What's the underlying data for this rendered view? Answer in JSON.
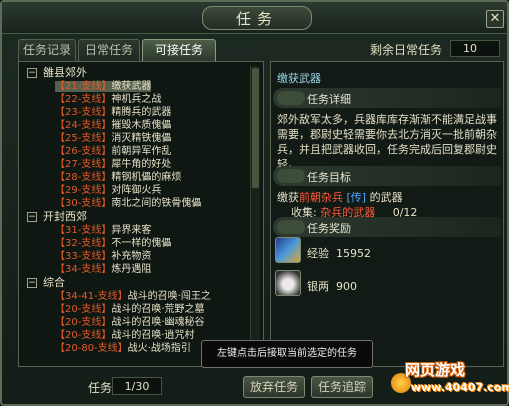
{
  "window": {
    "title": "任务",
    "close_label": "✕"
  },
  "tabs": [
    {
      "label": "任务记录"
    },
    {
      "label": "日常任务"
    },
    {
      "label": "可接任务"
    }
  ],
  "remaining": {
    "label": "剩余日常任务",
    "value": "10"
  },
  "tree": {
    "groups": [
      {
        "name": "雒县郊外",
        "toggle": "−",
        "tasks": [
          {
            "prefix": "【21-支线】",
            "text": "缴获武器",
            "selected": true
          },
          {
            "prefix": "【22-支线】",
            "text": "神机兵之战"
          },
          {
            "prefix": "【23-支线】",
            "text": "精腾兵的武器"
          },
          {
            "prefix": "【24-支线】",
            "text": "摧毁木质傀儡"
          },
          {
            "prefix": "【25-支线】",
            "text": "消灭精铁傀儡"
          },
          {
            "prefix": "【26-支线】",
            "text": "前朝异军作乱"
          },
          {
            "prefix": "【27-支线】",
            "text": "犀牛角的好处"
          },
          {
            "prefix": "【28-支线】",
            "text": "精钢机儡的麻烦"
          },
          {
            "prefix": "【29-支线】",
            "text": "对阵御火兵"
          },
          {
            "prefix": "【30-支线】",
            "text": "南北之间的铁骨傀儡"
          }
        ]
      },
      {
        "name": "开封西郊",
        "toggle": "−",
        "tasks": [
          {
            "prefix": "【31-支线】",
            "text": "异界来客"
          },
          {
            "prefix": "【32-支线】",
            "text": "不一样的傀儡"
          },
          {
            "prefix": "【33-支线】",
            "text": "补充物资"
          },
          {
            "prefix": "【34-支线】",
            "text": "炼丹遇阻"
          }
        ]
      },
      {
        "name": "综合",
        "toggle": "−",
        "tasks": [
          {
            "prefix": "【34-41-支线】",
            "text": "战斗的召唤·闯王之"
          },
          {
            "prefix": "【20-支线】",
            "text": "战斗的召唤·荒野之墓"
          },
          {
            "prefix": "【20-支线】",
            "text": "战斗的召唤·幽魂秘谷"
          },
          {
            "prefix": "【20-支线】",
            "text": "战斗的召唤·逍咒村"
          },
          {
            "prefix": "【20-80-支线】",
            "text": "战火·战场指引"
          }
        ]
      }
    ]
  },
  "detail": {
    "title": "缴获武器",
    "section_detail": "任务详细",
    "description": "郊外敌军太多，兵器库库存渐渐不能满足战事需要，郡尉史轻需要你去北方消灭一批前朝杂兵，并且把武器收回，任务完成后回复郡尉史轻。",
    "section_goal": "任务目标",
    "goal_prefix": "缴获",
    "goal_enemy": "前朝杂兵",
    "goal_tag": "[传]",
    "goal_suffix": "的武器",
    "collect_label": "收集:",
    "collect_item": "杂兵的武器",
    "collect_count": "0/12",
    "section_reward": "任务奖励",
    "rewards": [
      {
        "icon": "exp-icon",
        "label": "经验",
        "value": "15952"
      },
      {
        "icon": "silver-icon",
        "label": "银两",
        "value": "900"
      }
    ]
  },
  "footer": {
    "task_label": "任务",
    "task_count": "1/30",
    "abandon_label": "放弃任务",
    "track_label": "任务追踪"
  },
  "tooltip": "左键点击后接取当前选定的任务",
  "watermark": {
    "line1": "网页游戏",
    "line2": "www.40407.com"
  },
  "colors": {
    "accent_red": "#e65a2a",
    "accent_blue": "#4aa8ff",
    "title_cyan": "#9fd6e8"
  }
}
